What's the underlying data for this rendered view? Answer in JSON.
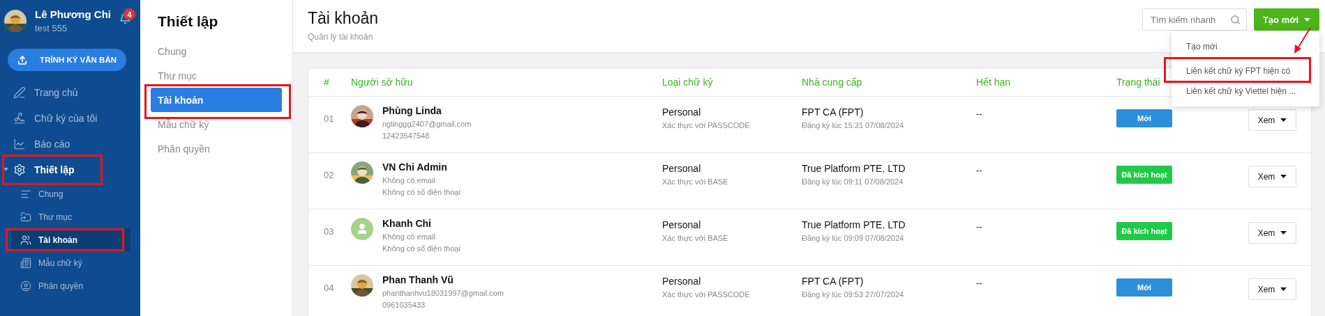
{
  "user": {
    "name": "Lê Phương Chi",
    "subtitle": "test 555",
    "notification_count": "4"
  },
  "primary_button": "TRÌNH KÝ VĂN BẢN",
  "sidebar": {
    "items": [
      {
        "label": "Trang chủ",
        "selected": false,
        "highlighted": false
      },
      {
        "label": "Chữ ký của tôi",
        "selected": false,
        "highlighted": false
      },
      {
        "label": "Báo cáo",
        "selected": false,
        "highlighted": false
      },
      {
        "label": "Thiết lập",
        "selected": true,
        "highlighted": true,
        "expanded": true,
        "children": [
          {
            "label": "Chung",
            "selected": false,
            "highlighted": false
          },
          {
            "label": "Thư mục",
            "selected": false,
            "highlighted": false
          },
          {
            "label": "Tài khoản",
            "selected": true,
            "highlighted": true
          },
          {
            "label": "Mẫu chữ ký",
            "selected": false,
            "highlighted": false
          },
          {
            "label": "Phân quyền",
            "selected": false,
            "highlighted": false
          }
        ]
      }
    ]
  },
  "settings_menu": {
    "title": "Thiết lập",
    "items": [
      {
        "label": "Chung",
        "selected": false,
        "highlighted": false
      },
      {
        "label": "Thư mục",
        "selected": false,
        "highlighted": false
      },
      {
        "label": "Tài khoản",
        "selected": true,
        "highlighted": true
      },
      {
        "label": "Mẫu chữ ký",
        "selected": false,
        "highlighted": false
      },
      {
        "label": "Phân quyền",
        "selected": false,
        "highlighted": false
      }
    ]
  },
  "page": {
    "title": "Tài khoản",
    "subtitle": "Quản lý tài khoản"
  },
  "search": {
    "placeholder": "Tìm kiếm nhanh"
  },
  "create_button": {
    "label": "Tạo mới",
    "expanded": true
  },
  "create_menu": {
    "arrow": true,
    "items": [
      {
        "label": "Tạo mới",
        "highlighted": false
      },
      {
        "label": "Liên kết chữ ký FPT hiện có",
        "highlighted": true
      },
      {
        "label": "Liên kết chữ ký Viettel hiện ...",
        "highlighted": false
      }
    ]
  },
  "table": {
    "columns": [
      "#",
      "Người sở hữu",
      "Loại chữ ký",
      "Nhà cung cấp",
      "Hết hạn",
      "Trạng thái"
    ],
    "rows": [
      {
        "index": "01",
        "name": "Phùng Linda",
        "email": "nglinggg2407@gmail.com",
        "phone": "12423547548",
        "type": "Personal",
        "auth": "Xác thực với PASSCODE",
        "provider": "FPT CA (FPT)",
        "registered": "Đăng ký lúc 15:31 07/08/2024",
        "expiry": "--",
        "status": {
          "label": "Mới",
          "color": "#2d8fd9"
        },
        "action": "Xem"
      },
      {
        "index": "02",
        "name": "VN Chi Admin",
        "email": "Không có email",
        "phone": "Không có số điện thoại",
        "type": "Personal",
        "auth": "Xác thực với BASE",
        "provider": "True Platform PTE. LTD",
        "registered": "Đăng ký lúc 09:11 07/08/2024",
        "expiry": "--",
        "status": {
          "label": "Đã kích hoạt",
          "color": "#1fca48"
        },
        "action": "Xem"
      },
      {
        "index": "03",
        "avatar": {
          "kind": "placeholder"
        },
        "name": "Khanh Chi",
        "email": "Không có email",
        "phone": "Không có số điện thoại",
        "type": "Personal",
        "auth": "Xác thực với BASE",
        "provider": "True Platform PTE. LTD",
        "registered": "Đăng ký lúc 09:09 07/08/2024",
        "expiry": "--",
        "status": {
          "label": "Đã kích hoạt",
          "color": "#1fca48"
        },
        "action": "Xem"
      },
      {
        "index": "04",
        "name": "Phan Thanh Vũ",
        "email": "phanthanhvu18031997@gmail.com",
        "phone": "0961035433",
        "type": "Personal",
        "auth": "Xác thực với PASSCODE",
        "provider": "FPT CA (FPT)",
        "registered": "Đăng ký lúc 09:53 27/07/2024",
        "expiry": "--",
        "status": {
          "label": "Mới",
          "color": "#2d8fd9"
        },
        "action": "Xem"
      }
    ]
  }
}
